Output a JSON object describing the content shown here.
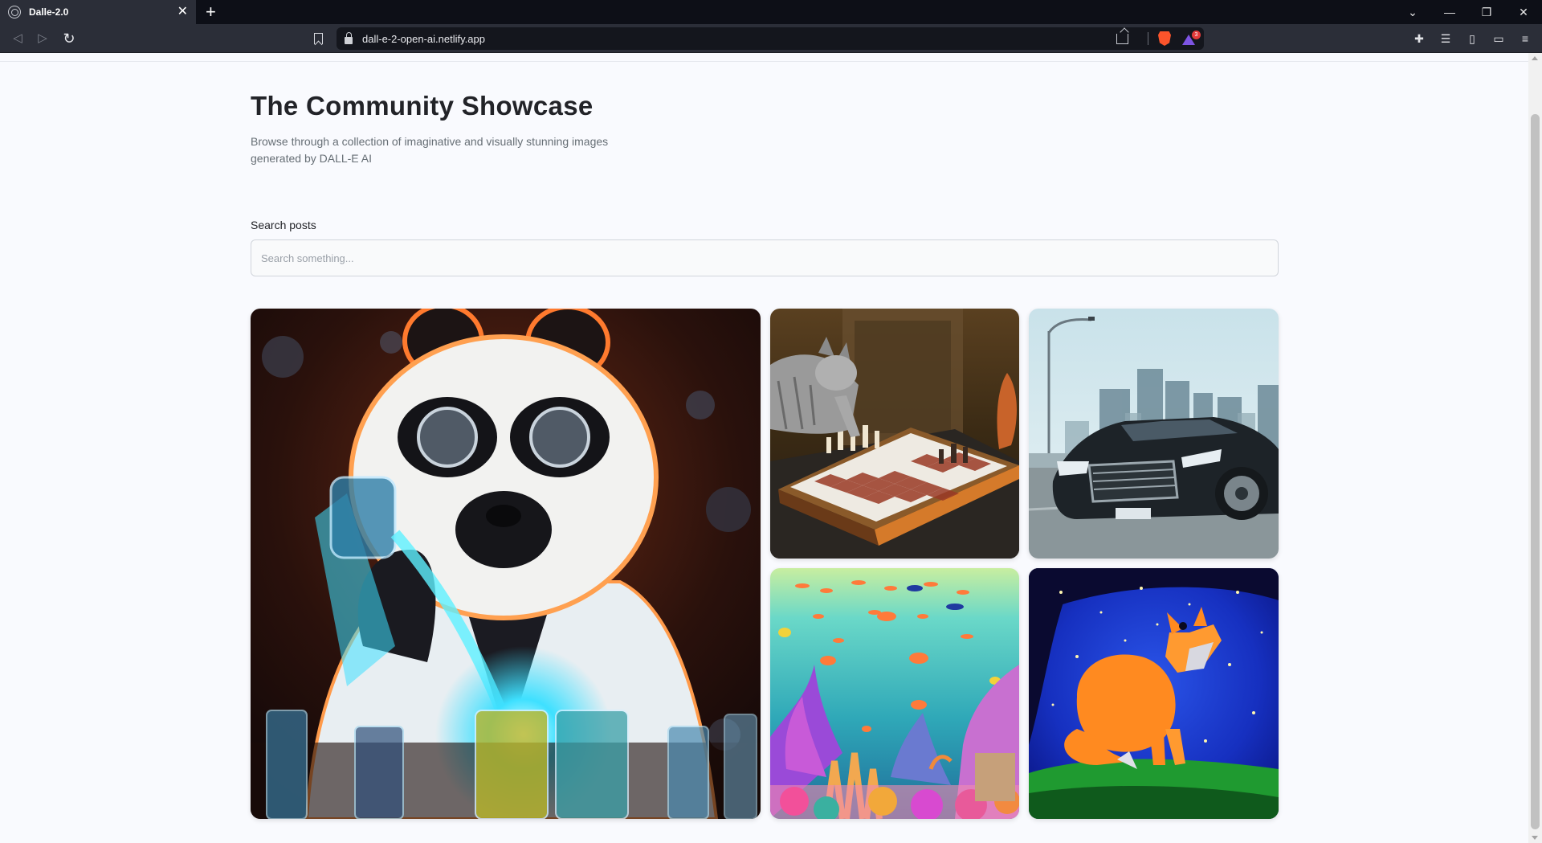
{
  "browser": {
    "tab_title": "Dalle-2.0",
    "url": "dall-e-2-open-ai.netlify.app",
    "rewards_badge": "3"
  },
  "page": {
    "title": "The Community Showcase",
    "subtitle": "Browse through a collection of imaginative and visually stunning images generated by DALL-E AI",
    "search": {
      "label": "Search posts",
      "placeholder": "Search something...",
      "value": ""
    }
  },
  "gallery": [
    {
      "name": "panda-scientist-image",
      "colors": [
        "#2a1510",
        "#ff7a2e",
        "#3ee0ff"
      ]
    },
    {
      "name": "cat-chess-image",
      "colors": [
        "#3a2a14",
        "#a05a3a",
        "#eeeae2"
      ]
    },
    {
      "name": "black-sedan-image",
      "colors": [
        "#b9d4de",
        "#1d2328",
        "#8fa0a8"
      ]
    },
    {
      "name": "coral-reef-image",
      "colors": [
        "#3bc6c9",
        "#ff7a3a",
        "#d64ad8"
      ]
    },
    {
      "name": "fox-starry-image",
      "colors": [
        "#0a1aa0",
        "#ff8a20",
        "#1f9a30"
      ]
    }
  ]
}
